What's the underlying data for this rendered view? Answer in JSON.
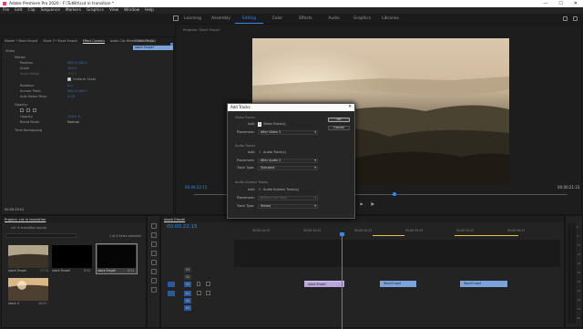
{
  "window": {
    "title": "Adobe Premiere Pro 2020 - F:\\TutBit\\cut in transition *",
    "controls": [
      "—",
      "☐",
      "✕"
    ]
  },
  "menu": [
    "File",
    "Edit",
    "Clip",
    "Sequence",
    "Markers",
    "Graphics",
    "View",
    "Window",
    "Help"
  ],
  "workspaces": {
    "items": [
      "Learning",
      "Assembly",
      "Editing",
      "Color",
      "Effects",
      "Audio",
      "Graphics",
      "Libraries"
    ],
    "active": "Editing"
  },
  "effect_controls": {
    "tabs": [
      "Master * Stock Emps4",
      "Stock 3 * Stock Emps4",
      "Effect Controls",
      "Audio Clip Mixer: Stock Emps4"
    ],
    "timecode": "00:00:19:22",
    "clip_label": "stock Empel",
    "rows": [
      {
        "label": "Video",
        "value": ""
      },
      {
        "label": "Motion",
        "value": ""
      },
      {
        "label": "Position",
        "value": "960.0   540.0"
      },
      {
        "label": "Scale",
        "value": "100.0"
      },
      {
        "label": "Scale Width",
        "value": "100.0"
      },
      {
        "label": "",
        "value": "Uniform Scale"
      },
      {
        "label": "Rotation",
        "value": "0.0"
      },
      {
        "label": "Anchor Point",
        "value": "960.0   540.0"
      },
      {
        "label": "Anti-flicker Filter",
        "value": "0.00"
      },
      {
        "label": "Opacity",
        "value": ""
      },
      {
        "label": "",
        "value": ""
      },
      {
        "label": "Opacity",
        "value": "100.0 %"
      },
      {
        "label": "Blend Mode",
        "value": "Normal"
      },
      {
        "label": "Time Remapping",
        "value": ""
      }
    ],
    "footer_timecode": "00:00:19:22"
  },
  "program": {
    "tab": "Program: Stock Empel",
    "tc_left": "00:00:22:15",
    "tc_right": "00:00:21:23"
  },
  "dialog": {
    "title": "Add Tracks",
    "ok": "OK",
    "cancel": "Cancel",
    "video": {
      "heading": "Video Tracks",
      "add_label": "Add:",
      "add_count": "1",
      "add_text": "Video Track(s)",
      "placement_label": "Placement:",
      "placement": "After Video 3"
    },
    "audio": {
      "heading": "Audio Tracks",
      "add_label": "Add:",
      "add_count": "1",
      "add_text": "Audio Track(s)",
      "placement_label": "Placement:",
      "placement": "After Audio 3",
      "type_label": "Track Type:",
      "type": "Standard"
    },
    "submix": {
      "heading": "Audio Submix Tracks",
      "add_label": "Add:",
      "add_count": "0",
      "add_text": "Audio Submix Track(s)",
      "placement_label": "Placement:",
      "placement": "Before First Track",
      "type_label": "Track Type:",
      "type": "Stereo"
    }
  },
  "project": {
    "tab": "Project: cut in transition",
    "file": "cut in transition.prproj",
    "count": "1 of 4 items selected",
    "items": [
      {
        "name": "stock Empel",
        "dur": "17:14"
      },
      {
        "name": "stock Empel",
        "dur": "8:05"
      },
      {
        "name": "stock Empel",
        "dur": "8:01"
      },
      {
        "name": "stock 4",
        "dur": "48:05"
      }
    ]
  },
  "timeline": {
    "tab": "stock Empel",
    "timecode": "00:00:22:15",
    "ruler": [
      "00:00:14:23",
      "00:00:19:23",
      "00:00:24:23",
      "00:00:29:23",
      "00:00:34:23",
      "00:00:39:23"
    ],
    "tracks": [
      "V3",
      "V2",
      "V1",
      "A1",
      "A2",
      "A3"
    ],
    "clips": [
      {
        "name": "stock Empel",
        "color": "#b9a6dc"
      },
      {
        "name": "Stock3.mp4",
        "color": "#7ba3dc"
      },
      {
        "name": "Stock3.mp4",
        "color": "#7ba3dc"
      }
    ]
  },
  "meter": {
    "scale": [
      "0",
      "-6",
      "-12",
      "-18",
      "-24",
      "-30",
      "-36",
      "-42",
      "-48",
      "-54",
      "dB"
    ]
  }
}
